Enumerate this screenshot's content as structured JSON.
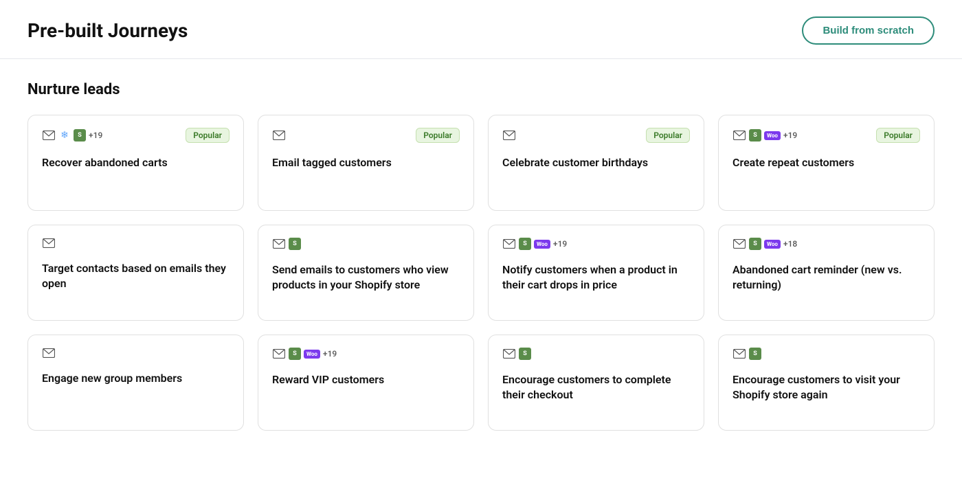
{
  "header": {
    "title": "Pre-built Journeys",
    "build_button_label": "Build from scratch"
  },
  "section": {
    "title": "Nurture leads"
  },
  "rows": [
    {
      "id": "row1",
      "cards": [
        {
          "id": "recover-abandoned-carts",
          "title": "Recover abandoned carts",
          "popular": true,
          "icons": [
            "email",
            "snowflake",
            "shopify"
          ],
          "count": "+19"
        },
        {
          "id": "email-tagged-customers",
          "title": "Email tagged customers",
          "popular": true,
          "icons": [
            "email"
          ],
          "count": null
        },
        {
          "id": "celebrate-birthdays",
          "title": "Celebrate customer birthdays",
          "popular": true,
          "icons": [
            "email"
          ],
          "count": null
        },
        {
          "id": "create-repeat-customers",
          "title": "Create repeat customers",
          "popular": true,
          "icons": [
            "email",
            "shopify",
            "woo"
          ],
          "count": "+19"
        }
      ]
    },
    {
      "id": "row2",
      "cards": [
        {
          "id": "target-contacts",
          "title": "Target contacts based on emails they open",
          "popular": false,
          "icons": [
            "email"
          ],
          "count": null
        },
        {
          "id": "send-emails-view-products",
          "title": "Send emails to customers who view products in your Shopify store",
          "popular": false,
          "icons": [
            "email",
            "shopify"
          ],
          "count": null
        },
        {
          "id": "notify-cart-price-drop",
          "title": "Notify customers when a product in their cart drops in price",
          "popular": false,
          "icons": [
            "email",
            "shopify",
            "woo"
          ],
          "count": "+19"
        },
        {
          "id": "abandoned-cart-reminder",
          "title": "Abandoned cart reminder (new vs. returning)",
          "popular": false,
          "icons": [
            "email",
            "shopify",
            "woo"
          ],
          "count": "+18"
        }
      ]
    },
    {
      "id": "row3",
      "cards": [
        {
          "id": "engage-new-group-members",
          "title": "Engage new group members",
          "popular": false,
          "icons": [
            "email"
          ],
          "count": null
        },
        {
          "id": "reward-vip-customers",
          "title": "Reward VIP customers",
          "popular": false,
          "icons": [
            "email",
            "shopify",
            "woo"
          ],
          "count": "+19"
        },
        {
          "id": "encourage-complete-checkout",
          "title": "Encourage customers to complete their checkout",
          "popular": false,
          "icons": [
            "email",
            "shopify"
          ],
          "count": null
        },
        {
          "id": "encourage-visit-shopify",
          "title": "Encourage customers to visit your Shopify store again",
          "popular": false,
          "icons": [
            "email",
            "shopify"
          ],
          "count": null
        }
      ]
    }
  ],
  "labels": {
    "popular": "Popular"
  }
}
